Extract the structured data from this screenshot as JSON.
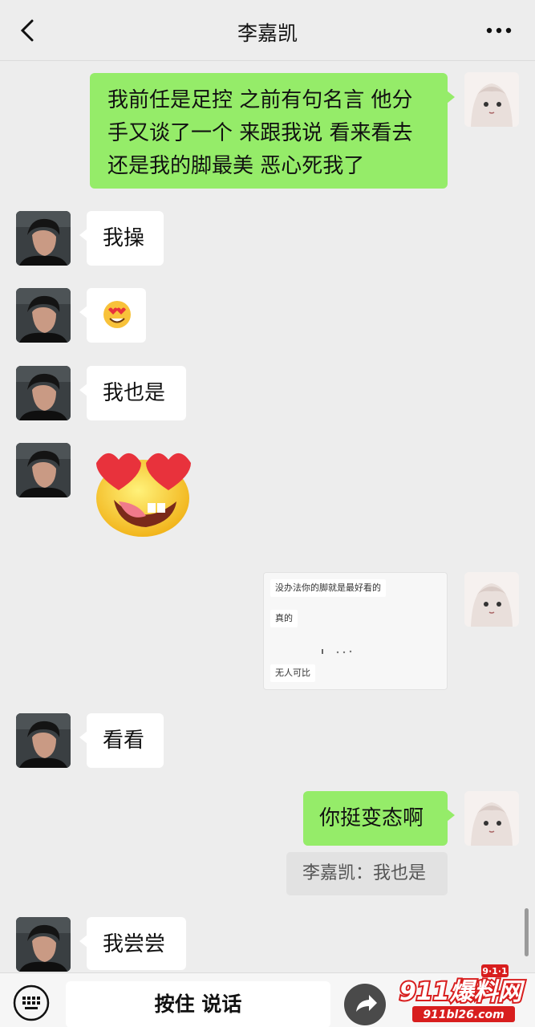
{
  "header": {
    "title": "李嘉凯",
    "back_icon": "chevron-left-icon",
    "more_icon": "more-dots-icon"
  },
  "messages": [
    {
      "from": "self",
      "type": "text",
      "text_lines": [
        "我前任是足控 之前有句名言 他分",
        "手又谈了一个 来跟我说 看来看去",
        "还是我的脚最美 恶心死我了"
      ]
    },
    {
      "from": "friend",
      "type": "text",
      "text": "我操"
    },
    {
      "from": "friend",
      "type": "emoji",
      "emoji": "😍"
    },
    {
      "from": "friend",
      "type": "text",
      "text": "我也是"
    },
    {
      "from": "friend",
      "type": "sticker",
      "sticker": "heart-eyes-tongue-sticker"
    },
    {
      "from": "self",
      "type": "image",
      "image_lines": [
        "没办法你的脚就是最好看的",
        "真的",
        "无人可比"
      ]
    },
    {
      "from": "friend",
      "type": "text",
      "text": "看看"
    },
    {
      "from": "self",
      "type": "text",
      "text": "你挺变态啊",
      "quote": "李嘉凯：我也是"
    },
    {
      "from": "friend",
      "type": "text",
      "text": "我尝尝"
    }
  ],
  "bottom_bar": {
    "keyboard_icon": "keyboard-icon",
    "voice_label": "按住 说话",
    "share_icon": "share-arrow-icon"
  },
  "watermark": {
    "brand": "911爆料网",
    "badge": "9·1·1",
    "url": "911bl26.com"
  },
  "colors": {
    "background": "#ededed",
    "outgoing_bubble": "#95ec69",
    "incoming_bubble": "#ffffff",
    "watermark_red": "#d81e1e"
  }
}
